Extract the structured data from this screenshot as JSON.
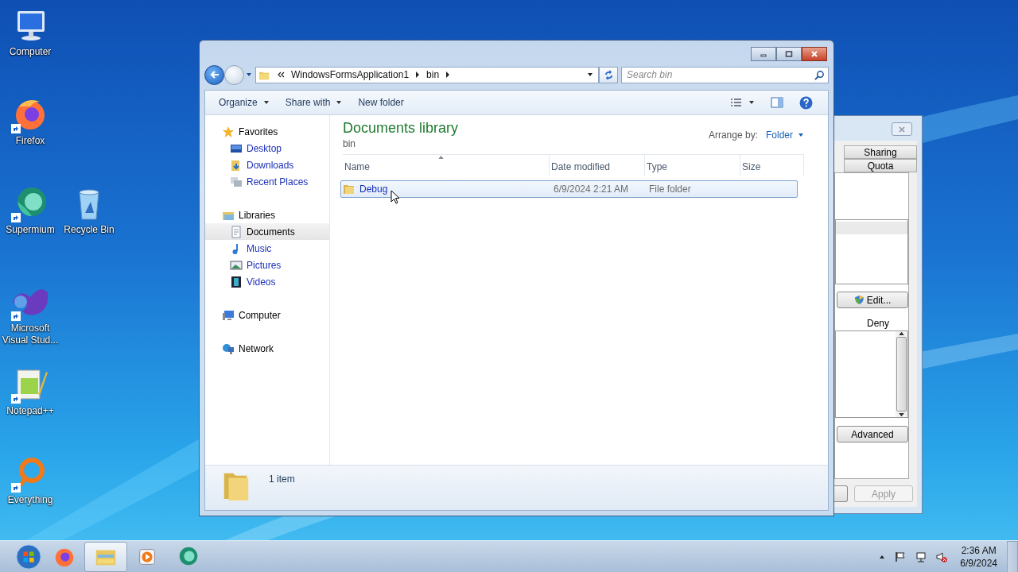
{
  "desktop_icons": [
    {
      "label": "Computer",
      "kind": "computer"
    },
    {
      "label": "Firefox",
      "kind": "firefox"
    },
    {
      "label": "Supermium",
      "kind": "supermium"
    },
    {
      "label": "Recycle Bin",
      "kind": "recycle"
    },
    {
      "label": "Microsoft Visual Stud...",
      "kind": "vs"
    },
    {
      "label": "Notepad++",
      "kind": "notepad"
    },
    {
      "label": "Everything",
      "kind": "everything"
    }
  ],
  "explorer": {
    "address": [
      "WindowsFormsApplication1",
      "bin"
    ],
    "search": {
      "placeholder": "Search bin"
    },
    "toolbar": [
      {
        "label": "Organize",
        "dropdown": true
      },
      {
        "label": "Share with",
        "dropdown": true
      },
      {
        "label": "New folder",
        "dropdown": false
      }
    ],
    "nav": [
      {
        "label": "Favorites",
        "kind": "star",
        "selected": false,
        "children": [
          {
            "label": "Desktop",
            "kind": "desktop",
            "selected": false
          },
          {
            "label": "Downloads",
            "kind": "downloads",
            "selected": false
          },
          {
            "label": "Recent Places",
            "kind": "recent",
            "selected": false
          }
        ]
      },
      {
        "label": "Libraries",
        "kind": "libraries",
        "selected": false,
        "children": [
          {
            "label": "Documents",
            "kind": "documents",
            "selected": true
          },
          {
            "label": "Music",
            "kind": "music",
            "selected": false
          },
          {
            "label": "Pictures",
            "kind": "pictures",
            "selected": false
          },
          {
            "label": "Videos",
            "kind": "videos",
            "selected": false
          }
        ]
      },
      {
        "label": "Computer",
        "kind": "computer",
        "selected": false
      },
      {
        "label": "Network",
        "kind": "network",
        "selected": false
      }
    ],
    "library": {
      "title": "Documents library",
      "subtitle": "bin",
      "arrange_label": "Arrange by:",
      "arrange_value": "Folder"
    },
    "columns": [
      "Name",
      "Date modified",
      "Type",
      "Size"
    ],
    "rows": [
      {
        "name": "Debug",
        "date": "6/9/2024 2:21 AM",
        "type": "File folder",
        "selected": true
      }
    ],
    "status": "1 item"
  },
  "properties_dialog": {
    "tabs": [
      "Sharing",
      "Quota"
    ],
    "edit_button": "Edit...",
    "deny_header": "Deny",
    "advanced_button": "Advanced",
    "apply_button": {
      "label": "Apply",
      "disabled": true
    }
  },
  "taskbar": {
    "apps": [
      {
        "kind": "firefox",
        "selected": false
      },
      {
        "kind": "explorer",
        "selected": true
      },
      {
        "kind": "media",
        "selected": false
      },
      {
        "kind": "supermium",
        "selected": false
      }
    ],
    "time": "2:36 AM",
    "date": "6/9/2024"
  }
}
